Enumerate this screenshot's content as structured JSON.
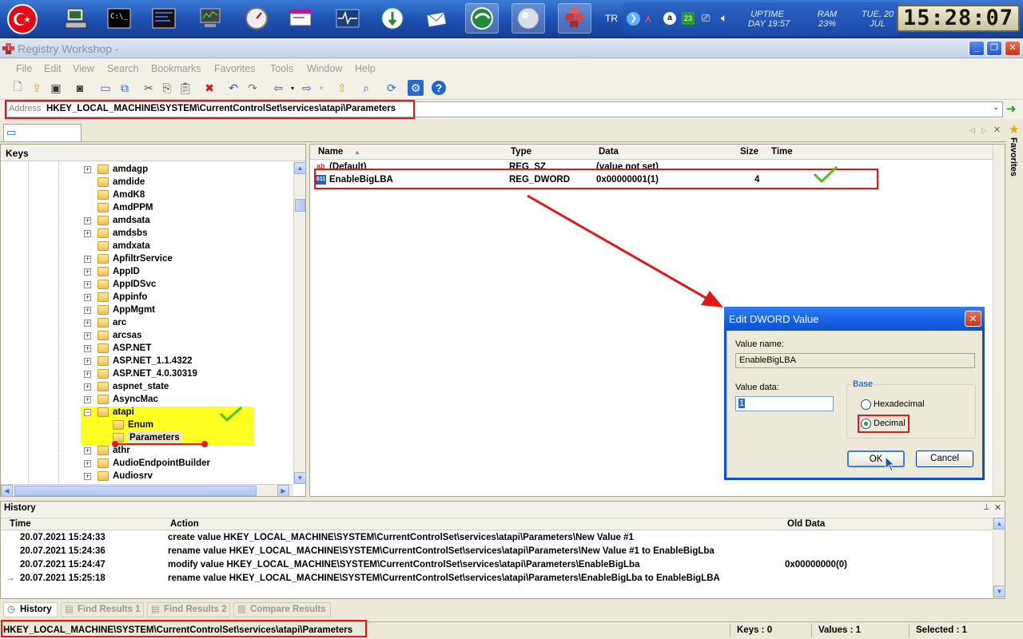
{
  "taskbar": {
    "lang": "TR",
    "uptime_label": "UPTIME",
    "uptime_value": "DAY 19:57",
    "ram_label": "RAM",
    "ram_value": "23%",
    "date_day": "TUE, 20",
    "date_month": "JUL",
    "clock": "15:28:07",
    "tray_badge": "23"
  },
  "window": {
    "title": "Registry Workshop -"
  },
  "menu": [
    "File",
    "Edit",
    "View",
    "Search",
    "Bookmarks",
    "Favorites",
    "Tools",
    "Window",
    "Help"
  ],
  "address": {
    "label": "Address",
    "value": "HKEY_LOCAL_MACHINE\\SYSTEM\\CurrentControlSet\\services\\atapi\\Parameters"
  },
  "keys": {
    "header": "Keys",
    "items": [
      {
        "label": "amdagp"
      },
      {
        "label": "amdide"
      },
      {
        "label": "AmdK8"
      },
      {
        "label": "AmdPPM"
      },
      {
        "label": "amdsata"
      },
      {
        "label": "amdsbs"
      },
      {
        "label": "amdxata"
      },
      {
        "label": "ApfiltrService"
      },
      {
        "label": "AppID"
      },
      {
        "label": "AppIDSvc"
      },
      {
        "label": "Appinfo"
      },
      {
        "label": "AppMgmt"
      },
      {
        "label": "arc"
      },
      {
        "label": "arcsas"
      },
      {
        "label": "ASP.NET"
      },
      {
        "label": "ASP.NET_1.1.4322"
      },
      {
        "label": "ASP.NET_4.0.30319"
      },
      {
        "label": "aspnet_state"
      },
      {
        "label": "AsyncMac"
      },
      {
        "label": "atapi"
      },
      {
        "label": "Enum"
      },
      {
        "label": "Parameters"
      },
      {
        "label": "athr"
      },
      {
        "label": "AudioEndpointBuilder"
      },
      {
        "label": "Audiosrv"
      }
    ]
  },
  "values": {
    "columns": {
      "name": "Name",
      "type": "Type",
      "data": "Data",
      "size": "Size",
      "time": "Time"
    },
    "rows": [
      {
        "name": "(Default)",
        "type": "REG_SZ",
        "data": "(value not set)",
        "size": ""
      },
      {
        "name": "EnableBigLBA",
        "type": "REG_DWORD",
        "data": "0x00000001(1)",
        "size": "4"
      }
    ]
  },
  "favorites_label": "Favorites",
  "dialog": {
    "title": "Edit DWORD Value",
    "value_name_label": "Value name:",
    "value_name": "EnableBigLBA",
    "value_data_label": "Value data:",
    "value_data": "1",
    "base_label": "Base",
    "hex_label": "Hexadecimal",
    "dec_label": "Decimal",
    "ok": "OK",
    "cancel": "Cancel"
  },
  "history": {
    "title": "History",
    "columns": {
      "time": "Time",
      "action": "Action",
      "old": "Old Data"
    },
    "rows": [
      {
        "time": "20.07.2021 15:24:33",
        "action": "create value HKEY_LOCAL_MACHINE\\SYSTEM\\CurrentControlSet\\services\\atapi\\Parameters\\New Value #1",
        "old": ""
      },
      {
        "time": "20.07.2021 15:24:36",
        "action": "rename value HKEY_LOCAL_MACHINE\\SYSTEM\\CurrentControlSet\\services\\atapi\\Parameters\\New Value #1 to EnableBigLba",
        "old": ""
      },
      {
        "time": "20.07.2021 15:24:47",
        "action": "modify value HKEY_LOCAL_MACHINE\\SYSTEM\\CurrentControlSet\\services\\atapi\\Parameters\\EnableBigLba",
        "old": "0x00000000(0)"
      },
      {
        "time": "20.07.2021 15:25:18",
        "action": "rename value HKEY_LOCAL_MACHINE\\SYSTEM\\CurrentControlSet\\services\\atapi\\Parameters\\EnableBigLba to EnableBigLBA",
        "old": ""
      }
    ]
  },
  "bottom_tabs": [
    "History",
    "Find Results 1",
    "Find Results 2",
    "Compare Results"
  ],
  "status": {
    "path": "HKEY_LOCAL_MACHINE\\SYSTEM\\CurrentControlSet\\services\\atapi\\Parameters",
    "keys": "Keys : 0",
    "values": "Values : 1",
    "selected": "Selected : 1"
  },
  "colors": {
    "highlight_red": "#e01818",
    "highlight_yellow": "#ffff22",
    "check_green": "#4cc21c"
  }
}
